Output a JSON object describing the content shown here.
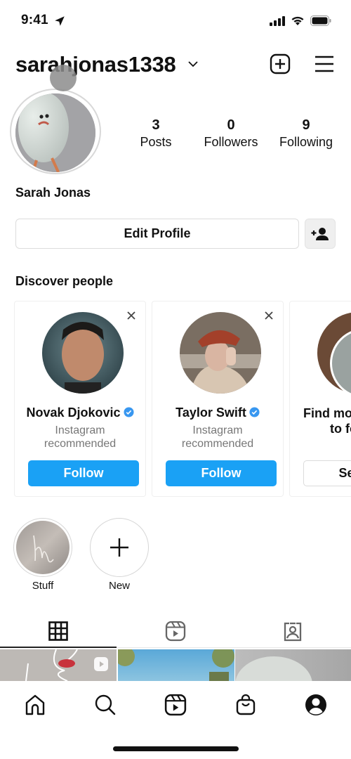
{
  "status_bar": {
    "time": "9:41",
    "icons": [
      "location-arrow-icon",
      "cellular-signal-icon",
      "wifi-icon",
      "battery-icon"
    ]
  },
  "header": {
    "username": "sarahjonas1338",
    "icons": [
      "chevron-down-icon",
      "new-post-icon",
      "menu-icon"
    ]
  },
  "profile": {
    "full_name": "Sarah Jonas",
    "stats": [
      {
        "value": "3",
        "label": "Posts"
      },
      {
        "value": "0",
        "label": "Followers"
      },
      {
        "value": "9",
        "label": "Following"
      }
    ],
    "edit_profile_label": "Edit Profile",
    "add_person_icon": "person-add-icon"
  },
  "discover": {
    "title": "Discover people",
    "cards": [
      {
        "name": "Novak Djokovic",
        "verified": true,
        "subtitle_line1": "Instagram",
        "subtitle_line2": "recommended",
        "button": "Follow"
      },
      {
        "name": "Taylor Swift",
        "verified": true,
        "subtitle_line1": "Instagram",
        "subtitle_line2": "recommended",
        "button": "Follow"
      },
      {
        "name": "Find more people",
        "name_line2": "to follow",
        "button": "See all"
      }
    ],
    "colors": {
      "follow_button": "#1aa1f5",
      "verified_badge": "#3897f0"
    }
  },
  "highlights": [
    {
      "label": "Stuff"
    },
    {
      "label": "New"
    }
  ],
  "tabs": [
    {
      "name": "posts-grid",
      "icon": "grid-icon",
      "active": true
    },
    {
      "name": "reels",
      "icon": "reels-icon",
      "active": false
    },
    {
      "name": "tagged",
      "icon": "tagged-icon",
      "active": false
    }
  ],
  "bottom_nav": [
    {
      "name": "home",
      "icon": "home-icon"
    },
    {
      "name": "search",
      "icon": "search-icon"
    },
    {
      "name": "reels",
      "icon": "reels-icon"
    },
    {
      "name": "shop",
      "icon": "shop-icon"
    },
    {
      "name": "profile",
      "icon": "profile-icon",
      "active": true
    }
  ]
}
